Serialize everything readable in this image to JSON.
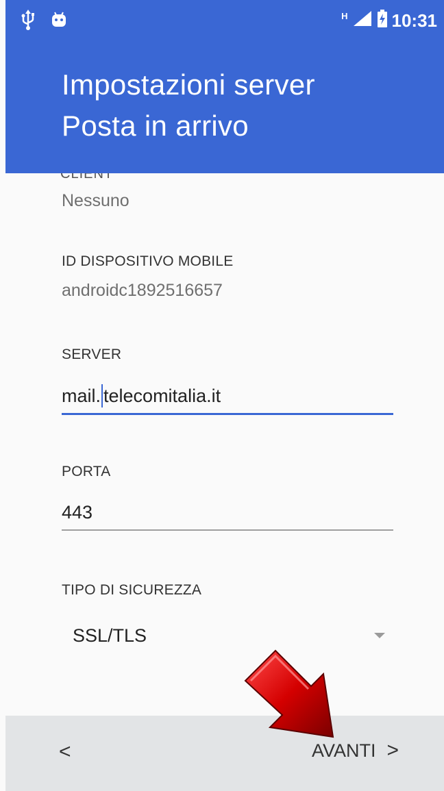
{
  "status_bar": {
    "left_icons": [
      "usb-icon",
      "android-debug-icon"
    ],
    "network_type": "H",
    "time": "10:31"
  },
  "header": {
    "title_line1": "Impostazioni server",
    "title_line2": "Posta in arrivo"
  },
  "form": {
    "cut_off_label": "CLIENT",
    "client_value": "Nessuno",
    "device_id_label": "ID DISPOSITIVO MOBILE",
    "device_id_value": "androidc1892516657",
    "server_label": "SERVER",
    "server_value_before_caret": "mail.",
    "server_value_after_caret": "telecomitalia.it",
    "port_label": "PORTA",
    "port_value": "443",
    "security_label": "TIPO DI SICUREZZA",
    "security_value": "SSL/TLS"
  },
  "footer": {
    "back_label": "<",
    "next_label": "AVANTI",
    "next_chevron": ">"
  },
  "colors": {
    "primary": "#3a67d4",
    "footer_bg": "#e2e4e6",
    "annotation_arrow": "#d40000"
  }
}
